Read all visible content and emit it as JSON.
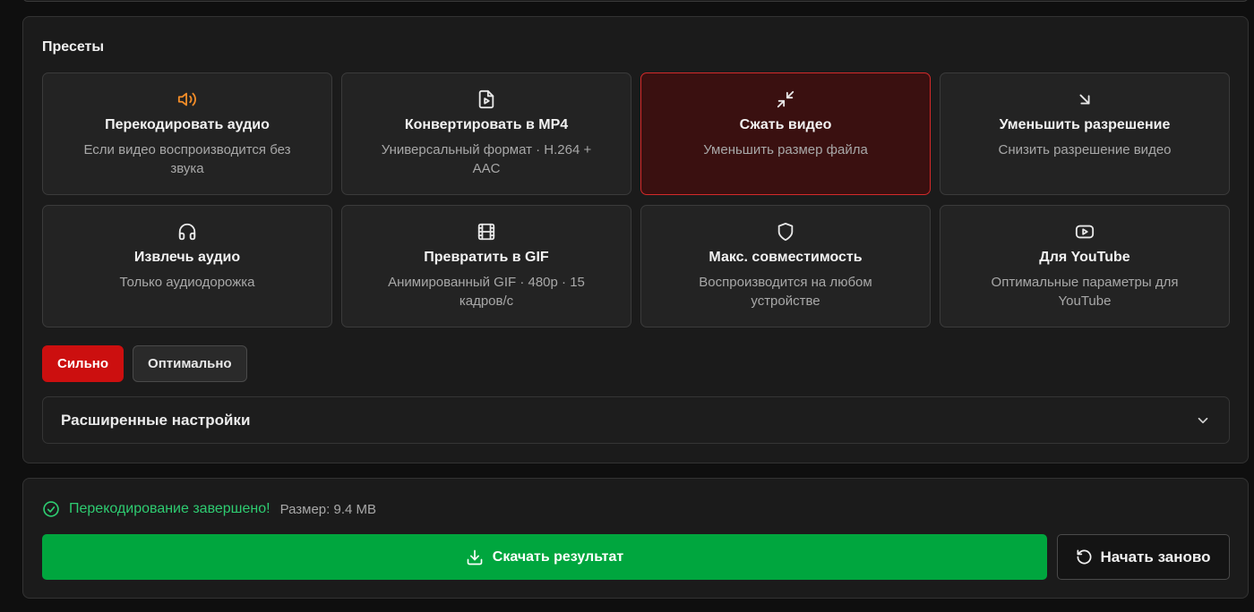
{
  "presets": {
    "title": "Пресеты",
    "items": [
      {
        "icon": "speaker-icon",
        "title": "Перекодировать аудио",
        "desc": "Если видео воспроизводится без звука",
        "active": false
      },
      {
        "icon": "video-file-icon",
        "title": "Конвертировать в MP4",
        "desc": "Универсальный формат · H.264 + AAC",
        "active": false
      },
      {
        "icon": "compress-arrows-icon",
        "title": "Сжать видео",
        "desc": "Уменьшить размер файла",
        "active": true
      },
      {
        "icon": "arrow-down-right-icon",
        "title": "Уменьшить разрешение",
        "desc": "Снизить разрешение видео",
        "active": false
      },
      {
        "icon": "headphones-icon",
        "title": "Извлечь аудио",
        "desc": "Только аудиодорожка",
        "active": false
      },
      {
        "icon": "film-icon",
        "title": "Превратить в GIF",
        "desc": "Анимированный GIF · 480p · 15 кадров/с",
        "active": false
      },
      {
        "icon": "shield-icon",
        "title": "Макс. совместимость",
        "desc": "Воспроизводится на любом устройстве",
        "active": false
      },
      {
        "icon": "youtube-icon",
        "title": "Для YouTube",
        "desc": "Оптимальные параметры для YouTube",
        "active": false
      }
    ]
  },
  "compression_levels": {
    "strong_label": "Сильно",
    "optimal_label": "Оптимально",
    "selected": "Сильно"
  },
  "advanced": {
    "label": "Расширенные настройки"
  },
  "result": {
    "status_text": "Перекодирование завершено!",
    "size_text": "Размер: 9.4 MB",
    "download_label": "Скачать результат",
    "restart_label": "Начать заново"
  },
  "colors": {
    "accent_red": "#cc0f0f",
    "success_green": "#00a63e",
    "status_green": "#2ecc71",
    "icon_orange": "#f28c28"
  }
}
